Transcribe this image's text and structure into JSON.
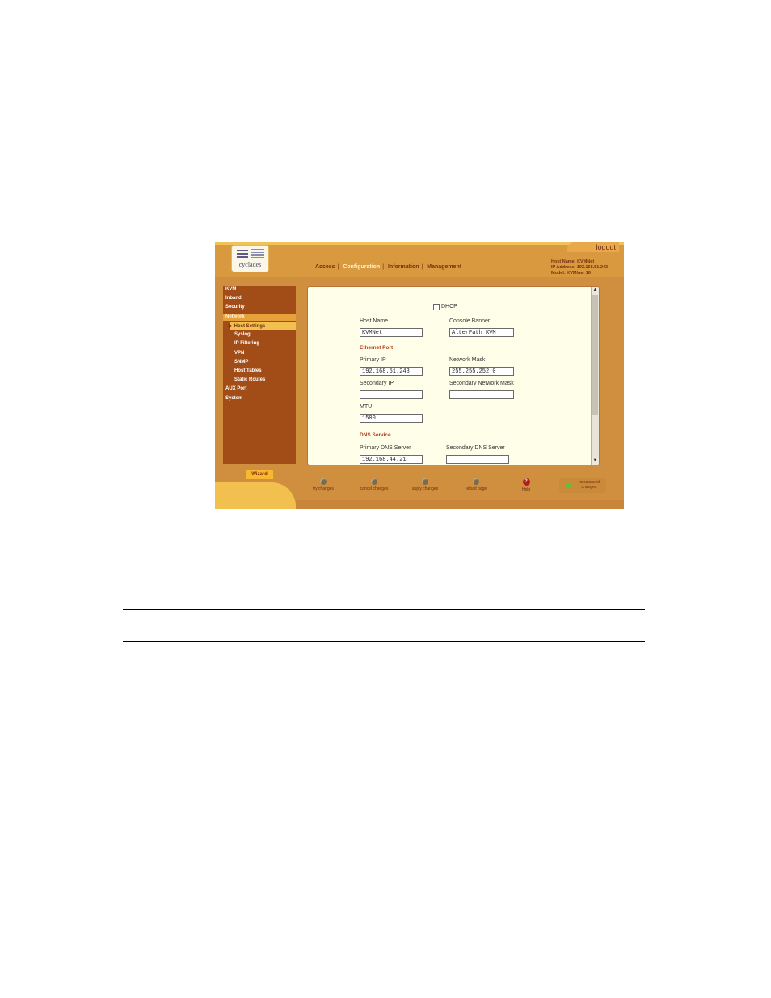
{
  "header": {
    "logo_text": "cyclades",
    "logout": "logout",
    "nav": [
      "Access",
      "Configuration",
      "Information",
      "Management"
    ],
    "active_nav": "Configuration",
    "host_info": [
      "Host Name: KVMNet",
      "IP Address: 192.168.51.243",
      "Model: KVM/net 16"
    ]
  },
  "sidebar": {
    "items": [
      "KVM",
      "Inband",
      "Security",
      "Network",
      "Host Settings",
      "Syslog",
      "IP Filtering",
      "VPN",
      "SNMP",
      "Host Tables",
      "Static Routes",
      "AUX Port",
      "System"
    ],
    "active_section": "Network",
    "active_item": "Host Settings"
  },
  "form": {
    "dhcp_label": "DHCP",
    "dhcp_checked": false,
    "host_name_label": "Host Name",
    "host_name_value": "KVMNet",
    "console_banner_label": "Console Banner",
    "console_banner_value": "AlterPath KVM",
    "ethernet_heading": "Ethernet Port",
    "primary_ip_label": "Primary IP",
    "primary_ip_value": "192.168.51.243",
    "network_mask_label": "Network Mask",
    "network_mask_value": "255.255.252.0",
    "secondary_ip_label": "Secondary IP",
    "secondary_ip_value": "",
    "secondary_mask_label": "Secondary Network Mask",
    "secondary_mask_value": "",
    "mtu_label": "MTU",
    "mtu_value": "1500",
    "dns_heading": "DNS Service",
    "primary_dns_label": "Primary DNS Server",
    "primary_dns_value": "192.168.44.21",
    "secondary_dns_label": "Secondary DNS Server",
    "secondary_dns_value": ""
  },
  "bottom": {
    "wizard": "Wizard",
    "actions": [
      "try changes",
      "cancel changes",
      "apply changes",
      "reload page",
      "Help"
    ],
    "status": "no unsaved changes"
  },
  "colors": {
    "frame": "#d08f3e",
    "sidebar": "#a24c17",
    "highlight": "#f2c04e",
    "content_bg": "#fffee9",
    "heading": "#b6371a",
    "status_led": "#3fcf3a"
  }
}
